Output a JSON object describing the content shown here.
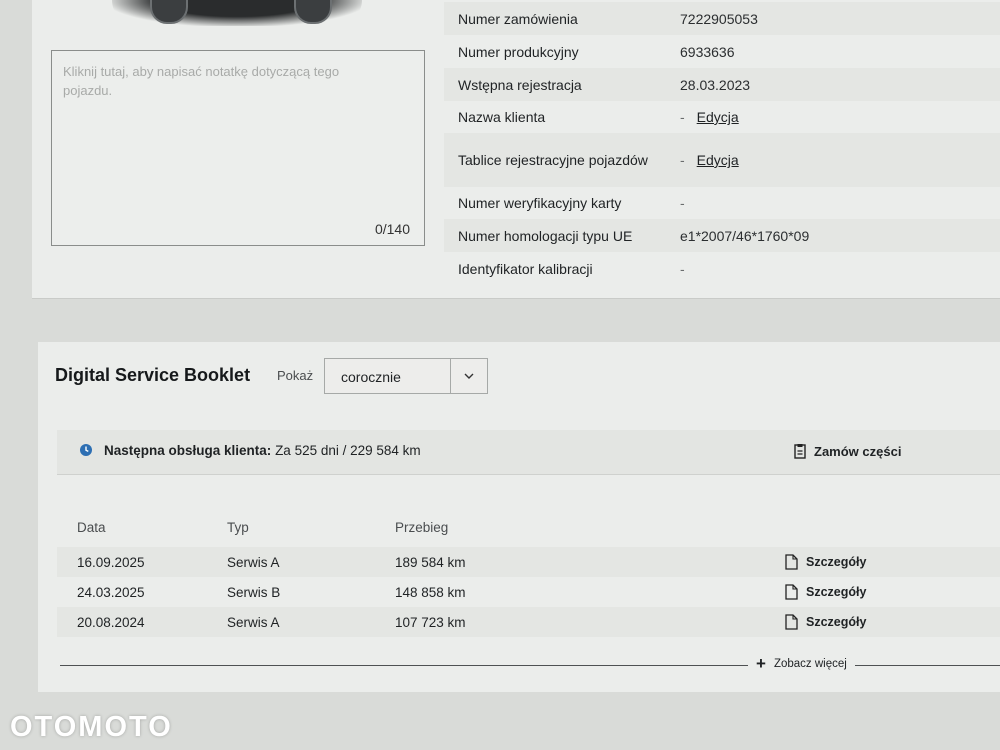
{
  "vehicle_info": {
    "rows": [
      {
        "label": "Numer zamówienia",
        "value": "7222905053"
      },
      {
        "label": "Numer produkcyjny",
        "value": "6933636"
      },
      {
        "label": "Wstępna rejestracja",
        "value": "28.03.2023"
      },
      {
        "label": "Nazwa klienta",
        "value": "-",
        "action": "Edycja"
      },
      {
        "label": "Tablice rejestracyjne pojazdów",
        "value": "-",
        "action": "Edycja"
      },
      {
        "label": "Numer weryfikacyjny karty",
        "value": "-"
      },
      {
        "label": "Numer homologacji typu UE",
        "value": "e1*2007/46*1760*09"
      },
      {
        "label": "Identyfikator kalibracji",
        "value": "-"
      }
    ]
  },
  "notes": {
    "placeholder": "Kliknij tutaj, aby napisać notatkę dotyczącą tego pojazdu.",
    "counter": "0/140"
  },
  "dsb": {
    "title": "Digital Service Booklet",
    "show_label": "Pokaż",
    "select_value": "corocznie",
    "next_service_label": "Następna obsługa klienta:",
    "next_service_value": "Za 525 dni / 229 584 km",
    "order_parts": "Zamów części",
    "columns": {
      "date": "Data",
      "type": "Typ",
      "mileage": "Przebieg"
    },
    "entries": [
      {
        "date": "16.09.2025",
        "type": "Serwis A",
        "mileage": "189 584 km",
        "details": "Szczegóły"
      },
      {
        "date": "24.03.2025",
        "type": "Serwis B",
        "mileage": "148 858 km",
        "details": "Szczegóły"
      },
      {
        "date": "20.08.2024",
        "type": "Serwis A",
        "mileage": "107 723 km",
        "details": "Szczegóły"
      }
    ],
    "see_more": "Zobacz więcej"
  },
  "watermark": "OTOMOTO"
}
